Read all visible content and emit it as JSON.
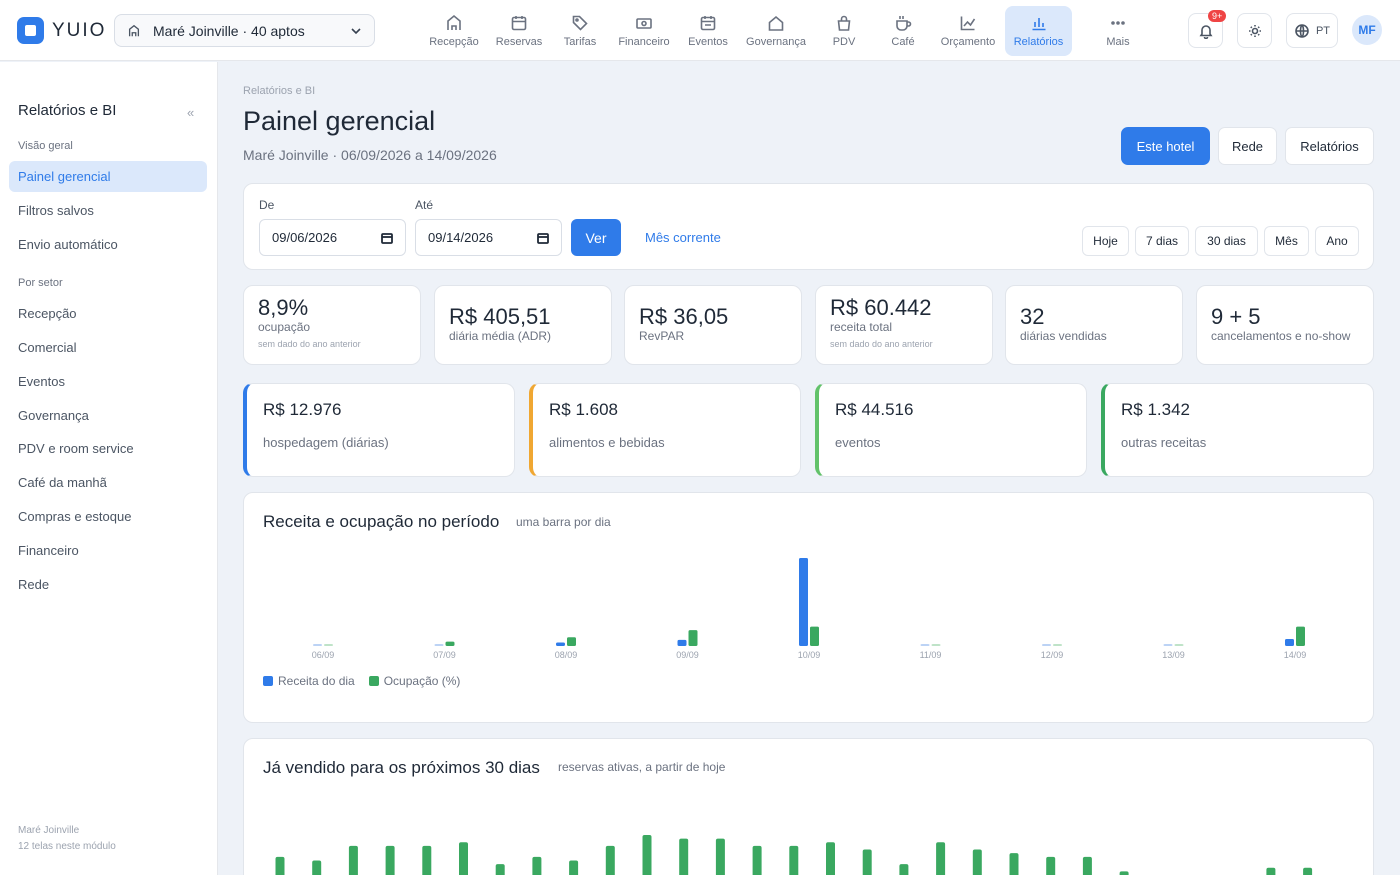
{
  "app": {
    "brand": "YUIO",
    "hotel_selector": "Maré Joinville · 40 aptos",
    "user_initials": "MF",
    "language": "PT",
    "notifications_badge": "9+"
  },
  "nav": [
    {
      "label": "Recepção",
      "icon": "building-icon"
    },
    {
      "label": "Reservas",
      "icon": "calendar-icon"
    },
    {
      "label": "Tarifas",
      "icon": "tag-icon"
    },
    {
      "label": "Financeiro",
      "icon": "money-icon"
    },
    {
      "label": "Eventos",
      "icon": "calendar-event-icon"
    },
    {
      "label": "Governança",
      "icon": "house-icon"
    },
    {
      "label": "PDV",
      "icon": "shopping-bag-icon"
    },
    {
      "label": "Café",
      "icon": "coffee-cup-icon"
    },
    {
      "label": "Orçamento",
      "icon": "line-chart-icon"
    },
    {
      "label": "Relatórios",
      "icon": "bar-chart-icon",
      "active": true
    },
    {
      "label": "Mais",
      "icon": "more-dots-icon"
    }
  ],
  "sidebar": {
    "title": "Relatórios e BI",
    "collapse": "«",
    "overview_heading": "Visão geral",
    "overview_items": [
      "Painel gerencial",
      "Filtros salvos",
      "Envio automático"
    ],
    "sector_heading": "Por setor",
    "sector_items": [
      "Recepção",
      "Comercial",
      "Eventos",
      "Governança",
      "PDV e room service",
      "Café da manhã",
      "Compras e estoque",
      "Financeiro",
      "Rede"
    ],
    "footer_hotel": "Maré Joinville",
    "footer_count": "12 telas neste módulo"
  },
  "page": {
    "breadcrumb": "Relatórios e BI",
    "title": "Painel gerencial",
    "subtitle": "Maré Joinville · 06/09/2026 a 14/09/2026",
    "scope_buttons": [
      "Este hotel",
      "Rede",
      "Relatórios"
    ]
  },
  "filters": {
    "from_label": "De",
    "from_value": "09/06/2026",
    "to_label": "Até",
    "to_value": "09/14/2026",
    "apply": "Ver",
    "current_month": "Mês corrente",
    "ranges": [
      "Hoje",
      "7 dias",
      "30 dias",
      "Mês",
      "Ano"
    ]
  },
  "kpis": [
    {
      "value": "8,9%",
      "label": "ocupação",
      "note": "sem dado do ano anterior"
    },
    {
      "value": "R$ 405,51",
      "label": "diária média (ADR)",
      "note": ""
    },
    {
      "value": "R$ 36,05",
      "label": "RevPAR",
      "note": ""
    },
    {
      "value": "R$ 60.442",
      "label": "receita total",
      "note": "sem dado do ano anterior"
    },
    {
      "value": "32",
      "label": "diárias vendidas",
      "note": ""
    },
    {
      "value": "9 + 5",
      "label": "cancelamentos e no-show",
      "note": ""
    }
  ],
  "revenue_cards": [
    {
      "value": "R$ 12.976",
      "label": "hospedagem (diárias)",
      "color": "#2f7be9"
    },
    {
      "value": "R$ 1.608",
      "label": "alimentos e bebidas",
      "color": "#f0a732"
    },
    {
      "value": "R$ 44.516",
      "label": "eventos",
      "color": "#62c26a"
    },
    {
      "value": "R$ 1.342",
      "label": "outras receitas",
      "color": "#3aa860"
    }
  ],
  "revenue_chart": {
    "title": "Receita e ocupação no período",
    "subtitle": "uma barra por dia",
    "legend": [
      "Receita do dia",
      "Ocupação (%)"
    ]
  },
  "forecast_chart": {
    "title": "Já vendido para os próximos 30 dias",
    "subtitle": "reservas ativas, a partir de hoje"
  },
  "colors": {
    "accent": "#2f7be9",
    "revenue": "#2f7be9",
    "occupancy": "#3aa860"
  },
  "chart_data": [
    {
      "type": "bar",
      "title": "Receita e ocupação no período",
      "subtitle": "uma barra por dia",
      "categories": [
        "06/09",
        "07/09",
        "08/09",
        "09/09",
        "10/09",
        "11/09",
        "12/09",
        "13/09",
        "14/09"
      ],
      "series": [
        {
          "name": "Receita do dia",
          "color": "#2f7be9",
          "values": [
            0,
            0,
            0.04,
            0.07,
            1.0,
            0,
            0,
            0,
            0.08
          ]
        },
        {
          "name": "Ocupação (%)",
          "color": "#3aa860",
          "values": [
            0,
            0.05,
            0.1,
            0.18,
            0.22,
            0,
            0,
            0,
            0.22
          ]
        }
      ],
      "grid": false,
      "legend_position": "bottom-left"
    },
    {
      "type": "bar",
      "title": "Já vendido para os próximos 30 dias",
      "subtitle": "reservas ativas, a partir de hoje",
      "series": [
        {
          "color": "#3aa860",
          "values": [
            5,
            4,
            8,
            8,
            8,
            9,
            3,
            5,
            4,
            8,
            11,
            10,
            10,
            8,
            8,
            9,
            7,
            3,
            9,
            7,
            6,
            5,
            5,
            1,
            0,
            0,
            0,
            2,
            2
          ]
        }
      ],
      "grid": false
    }
  ]
}
